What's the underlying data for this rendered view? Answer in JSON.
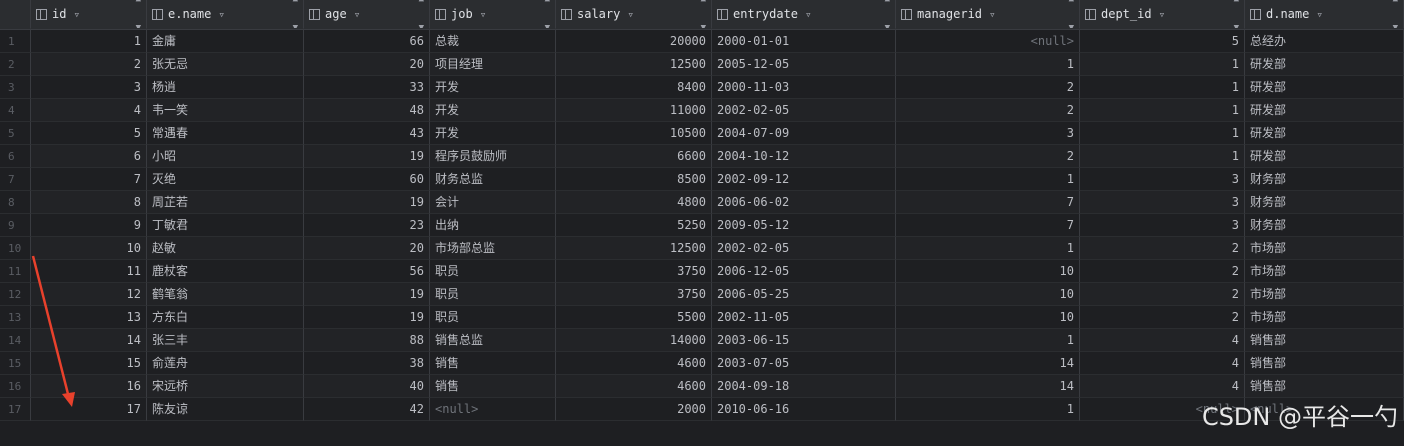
{
  "columns": [
    "id",
    "e.name",
    "age",
    "job",
    "salary",
    "entrydate",
    "managerid",
    "dept_id",
    "d.name"
  ],
  "icons": {
    "column": "column-icon",
    "filter": "filter-icon",
    "sort": "sort-icon"
  },
  "rows": [
    {
      "n": "1",
      "id": "1",
      "name": "金庸",
      "age": "66",
      "job": "总裁",
      "salary": "20000",
      "date": "2000-01-01",
      "mgr": "<null>",
      "dept": "5",
      "dname": "总经办"
    },
    {
      "n": "2",
      "id": "2",
      "name": "张无忌",
      "age": "20",
      "job": "项目经理",
      "salary": "12500",
      "date": "2005-12-05",
      "mgr": "1",
      "dept": "1",
      "dname": "研发部"
    },
    {
      "n": "3",
      "id": "3",
      "name": "杨逍",
      "age": "33",
      "job": "开发",
      "salary": "8400",
      "date": "2000-11-03",
      "mgr": "2",
      "dept": "1",
      "dname": "研发部"
    },
    {
      "n": "4",
      "id": "4",
      "name": "韦一笑",
      "age": "48",
      "job": "开发",
      "salary": "11000",
      "date": "2002-02-05",
      "mgr": "2",
      "dept": "1",
      "dname": "研发部"
    },
    {
      "n": "5",
      "id": "5",
      "name": "常遇春",
      "age": "43",
      "job": "开发",
      "salary": "10500",
      "date": "2004-07-09",
      "mgr": "3",
      "dept": "1",
      "dname": "研发部"
    },
    {
      "n": "6",
      "id": "6",
      "name": "小昭",
      "age": "19",
      "job": "程序员鼓励师",
      "salary": "6600",
      "date": "2004-10-12",
      "mgr": "2",
      "dept": "1",
      "dname": "研发部"
    },
    {
      "n": "7",
      "id": "7",
      "name": "灭绝",
      "age": "60",
      "job": "财务总监",
      "salary": "8500",
      "date": "2002-09-12",
      "mgr": "1",
      "dept": "3",
      "dname": "财务部"
    },
    {
      "n": "8",
      "id": "8",
      "name": "周芷若",
      "age": "19",
      "job": "会计",
      "salary": "4800",
      "date": "2006-06-02",
      "mgr": "7",
      "dept": "3",
      "dname": "财务部"
    },
    {
      "n": "9",
      "id": "9",
      "name": "丁敏君",
      "age": "23",
      "job": "出纳",
      "salary": "5250",
      "date": "2009-05-12",
      "mgr": "7",
      "dept": "3",
      "dname": "财务部"
    },
    {
      "n": "10",
      "id": "10",
      "name": "赵敏",
      "age": "20",
      "job": "市场部总监",
      "salary": "12500",
      "date": "2002-02-05",
      "mgr": "1",
      "dept": "2",
      "dname": "市场部"
    },
    {
      "n": "11",
      "id": "11",
      "name": "鹿杖客",
      "age": "56",
      "job": "职员",
      "salary": "3750",
      "date": "2006-12-05",
      "mgr": "10",
      "dept": "2",
      "dname": "市场部"
    },
    {
      "n": "12",
      "id": "12",
      "name": "鹤笔翁",
      "age": "19",
      "job": "职员",
      "salary": "3750",
      "date": "2006-05-25",
      "mgr": "10",
      "dept": "2",
      "dname": "市场部"
    },
    {
      "n": "13",
      "id": "13",
      "name": "方东白",
      "age": "19",
      "job": "职员",
      "salary": "5500",
      "date": "2002-11-05",
      "mgr": "10",
      "dept": "2",
      "dname": "市场部"
    },
    {
      "n": "14",
      "id": "14",
      "name": "张三丰",
      "age": "88",
      "job": "销售总监",
      "salary": "14000",
      "date": "2003-06-15",
      "mgr": "1",
      "dept": "4",
      "dname": "销售部"
    },
    {
      "n": "15",
      "id": "15",
      "name": "俞莲舟",
      "age": "38",
      "job": "销售",
      "salary": "4600",
      "date": "2003-07-05",
      "mgr": "14",
      "dept": "4",
      "dname": "销售部"
    },
    {
      "n": "16",
      "id": "16",
      "name": "宋远桥",
      "age": "40",
      "job": "销售",
      "salary": "4600",
      "date": "2004-09-18",
      "mgr": "14",
      "dept": "4",
      "dname": "销售部"
    },
    {
      "n": "17",
      "id": "17",
      "name": "陈友谅",
      "age": "42",
      "job": "<null>",
      "salary": "2000",
      "date": "2010-06-16",
      "mgr": "1",
      "dept": "<null>",
      "dname": "<null>"
    }
  ],
  "watermark": "CSDN @平谷一勺",
  "colors": {
    "annotation_arrow": "#e8412c"
  }
}
